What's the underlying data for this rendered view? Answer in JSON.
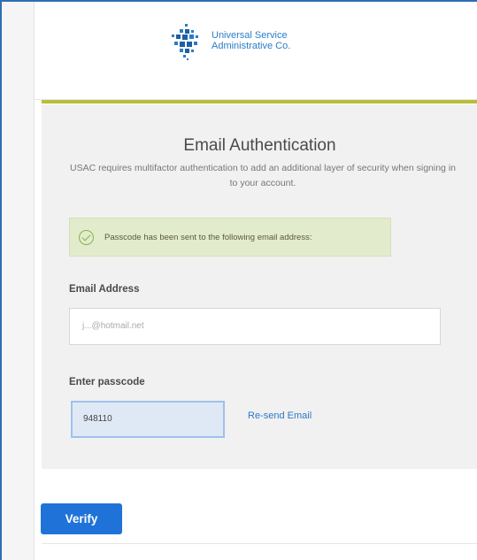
{
  "logo": {
    "line1": "Universal Service",
    "line2": "Administrative Co.",
    "brand_color": "#2a7dc6"
  },
  "card": {
    "title": "Email Authentication",
    "subtitle": "USAC requires multifactor authentication to add an additional layer of security when signing in to your account."
  },
  "alert": {
    "message": "Passcode has been sent to the following email address:",
    "icon": "check-circle-icon",
    "color": "#e2eccd"
  },
  "email": {
    "label": "Email Address",
    "value": "j...@hotmail.net"
  },
  "passcode": {
    "label": "Enter passcode",
    "value": "948110"
  },
  "actions": {
    "resend_label": "Re-send Email",
    "verify_label": "Verify",
    "accent_color": "#1f73d8"
  }
}
